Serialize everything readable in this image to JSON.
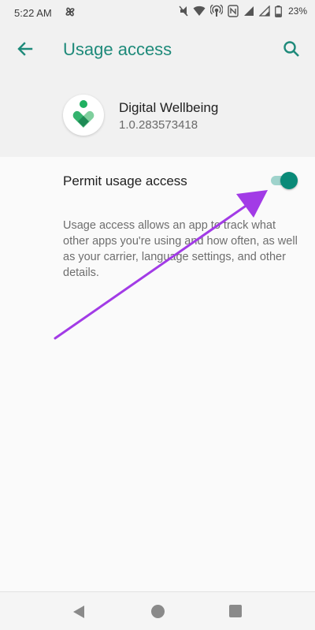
{
  "status_bar": {
    "time": "5:22 AM",
    "battery_percent": "23%",
    "icons": [
      "fan-icon",
      "mute-icon",
      "wifi-icon",
      "hotspot-icon",
      "nfc-icon",
      "signal-icon",
      "signal-icon",
      "battery-icon"
    ]
  },
  "app_bar": {
    "title": "Usage access"
  },
  "app_info": {
    "name": "Digital Wellbeing",
    "version": "1.0.283573418"
  },
  "permission": {
    "label": "Permit usage access",
    "enabled": true,
    "description": "Usage access allows an app to track what other apps you're using and how often, as well as your carrier, language settings, and other details."
  },
  "colors": {
    "accent": "#1e8a7a",
    "toggle_thumb": "#0a8a78",
    "toggle_track": "#9fd3cc",
    "annotation_arrow": "#a23be6"
  }
}
